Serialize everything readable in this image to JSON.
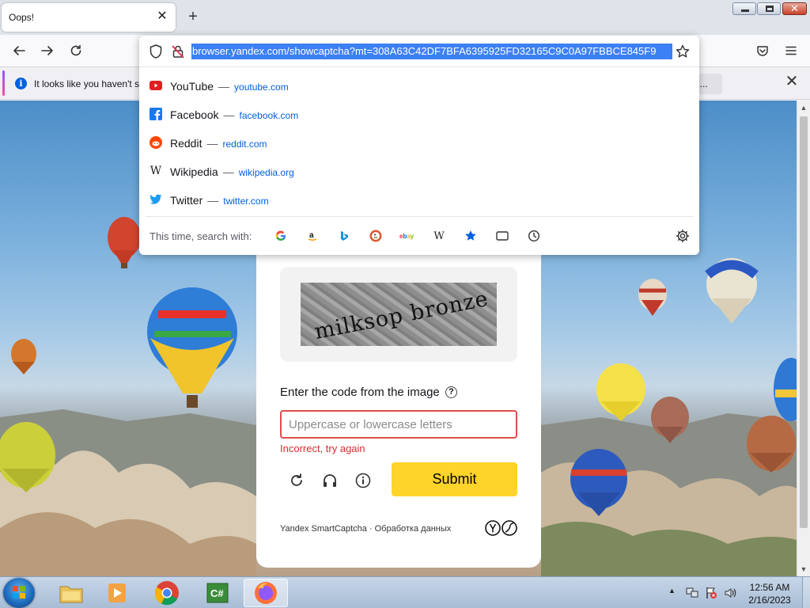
{
  "tab": {
    "title": "Oops!",
    "close_symbol": "✕"
  },
  "newtab_symbol": "+",
  "address_bar": {
    "url": "browser.yandex.com/showcaptcha?mt=308A63C42DF7BFA6395925FD32165C9C0A97FBBCE845F9"
  },
  "notification": {
    "text": "It looks like you haven't s",
    "button_label": "ox...",
    "info_symbol": "i",
    "close_symbol": "✕"
  },
  "suggestions": [
    {
      "name": "YouTube",
      "domain": "youtube.com",
      "icon": "youtube-icon"
    },
    {
      "name": "Facebook",
      "domain": "facebook.com",
      "icon": "facebook-icon"
    },
    {
      "name": "Reddit",
      "domain": "reddit.com",
      "icon": "reddit-icon"
    },
    {
      "name": "Wikipedia",
      "domain": "wikipedia.org",
      "icon": "wikipedia-icon"
    },
    {
      "name": "Twitter",
      "domain": "twitter.com",
      "icon": "twitter-icon"
    }
  ],
  "suggestion_separator": "—",
  "search_with": {
    "label": "This time, search with:",
    "engines": [
      "google",
      "amazon",
      "bing",
      "duckduckgo",
      "ebay",
      "wikipedia",
      "bookmarks",
      "tabs",
      "history"
    ]
  },
  "captcha": {
    "image_text": "milksop bronze",
    "label": "Enter the code from the image",
    "help_symbol": "?",
    "input_placeholder": "Uppercase or lowercase letters",
    "input_value": "",
    "error": "Incorrect, try again",
    "submit_label": "Submit",
    "footer": "Yandex SmartCaptcha · Обработка данных",
    "accent_color": "#fed42b",
    "error_color": "#d32f2f"
  },
  "taskbar": {
    "apps": [
      "explorer",
      "media-player",
      "chrome",
      "csharp-app",
      "firefox"
    ],
    "active_app": "firefox",
    "time": "12:56 AM",
    "date": "2/16/2023"
  }
}
